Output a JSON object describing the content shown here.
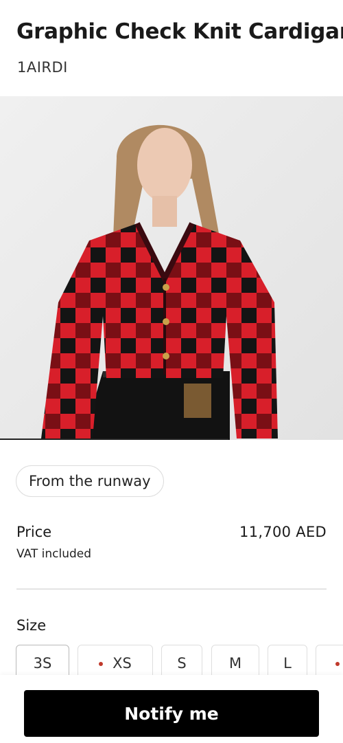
{
  "product": {
    "title": "Graphic Check Knit Cardigan",
    "sku": "1AIRDI"
  },
  "image": {
    "alt": "Graphic Check Knit Cardigan"
  },
  "tags": {
    "runway": "From the runway"
  },
  "price": {
    "label": "Price",
    "vat_note": "VAT included",
    "value": "11,700 AED"
  },
  "size": {
    "label": "Size",
    "options": [
      {
        "label": "3S",
        "low_stock": false,
        "selected": true
      },
      {
        "label": "XS",
        "low_stock": true,
        "selected": false
      },
      {
        "label": "S",
        "low_stock": false,
        "selected": false
      },
      {
        "label": "M",
        "low_stock": false,
        "selected": false
      },
      {
        "label": "L",
        "low_stock": false,
        "selected": false
      },
      {
        "label": "",
        "low_stock": true,
        "selected": false
      }
    ]
  },
  "cta": {
    "notify": "Notify me"
  },
  "colors": {
    "accent": "#000000",
    "low_stock_dot": "#c0392b",
    "check_red": "#d81f2a",
    "check_black": "#141414"
  }
}
